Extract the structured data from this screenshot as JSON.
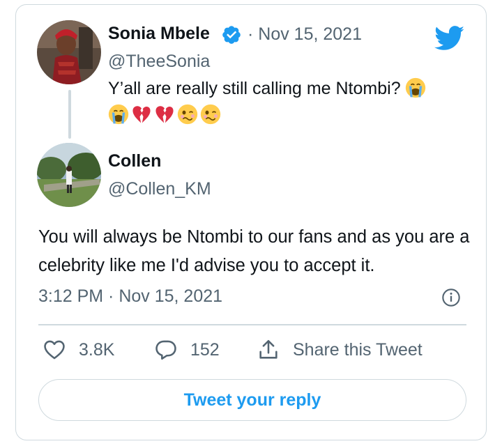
{
  "original_tweet": {
    "author_name": "Sonia Mbele",
    "separator_date": "· Nov 15, 2021",
    "handle": "@TheeSonia",
    "text": "Y’all are really still calling me Ntombi?",
    "verified_icon": "verified-badge-icon",
    "emojis": [
      "loudly-crying-face",
      "broken-heart",
      "broken-heart",
      "woozy-face",
      "woozy-face"
    ]
  },
  "reply_tweet": {
    "author_name": "Collen",
    "handle": "@Collen_KM",
    "text": "You will always be Ntombi to our fans and as you are a celebrity like me I'd advise you to accept it.",
    "timestamp": "3:12 PM · Nov 15, 2021"
  },
  "actions": {
    "likes": "3.8K",
    "replies": "152",
    "share_label": "Share this Tweet"
  },
  "reply_button_label": "Tweet your reply",
  "colors": {
    "accent": "#1d9bf0",
    "text_primary": "#0f1419",
    "text_secondary": "#536471",
    "border": "#cfd9de"
  },
  "icons": {
    "brand": "twitter-bird-icon",
    "info": "info-icon",
    "like": "heart-icon",
    "reply": "reply-bubble-icon",
    "share": "share-upload-icon"
  }
}
